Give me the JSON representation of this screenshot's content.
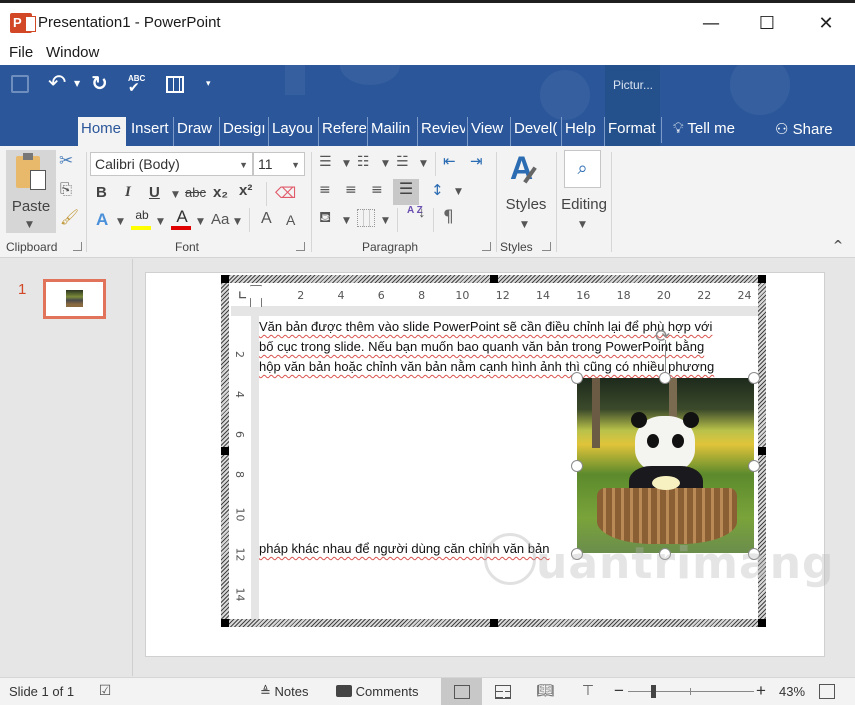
{
  "window": {
    "title": "Presentation1 - PowerPoint",
    "app_icon": "powerpoint-logo-icon",
    "controls": {
      "minimize": "—",
      "maximize": "☐",
      "close": "✕"
    }
  },
  "menubar": {
    "items": [
      "File",
      "Window"
    ]
  },
  "quick_access": {
    "icons": [
      "save-icon",
      "undo-icon",
      "undo-dropdown-icon",
      "redo-icon",
      "spelling-icon",
      "table-draw-icon",
      "customize-toolbar-icon"
    ],
    "spelling_label": "ABC"
  },
  "contextual_tab_group": "Pictur...",
  "tabs": [
    {
      "label": "Home",
      "active": true
    },
    {
      "label": "Insert"
    },
    {
      "label": "Draw"
    },
    {
      "label": "Desigı"
    },
    {
      "label": "Layou"
    },
    {
      "label": "Refere"
    },
    {
      "label": "Mailin"
    },
    {
      "label": "Reviev"
    },
    {
      "label": "View"
    },
    {
      "label": "Devel("
    },
    {
      "label": "Help"
    },
    {
      "label": "Format"
    }
  ],
  "tell_me": "Tell me",
  "share": "Share",
  "ribbon": {
    "clipboard": {
      "paste_label": "Paste",
      "group_label": "Clipboard",
      "icons": [
        "paste-icon",
        "cut-icon",
        "copy-icon",
        "format-painter-icon"
      ]
    },
    "font": {
      "font_name": "Calibri (Body)",
      "font_size": "11",
      "bold": "B",
      "italic": "I",
      "underline": "U",
      "strikethrough": "abc",
      "subscript": "x₂",
      "superscript": "x²",
      "text_effects": "A",
      "highlight": "ab",
      "font_color": "A",
      "change_case": "Aa",
      "grow": "A",
      "shrink": "A",
      "group_label": "Font",
      "highlight_color": "#ffff00",
      "font_color_value": "#e00000"
    },
    "paragraph": {
      "group_label": "Paragraph",
      "icons": [
        "bullets-icon",
        "numbering-icon",
        "multilevel-list-icon",
        "decrease-indent-icon",
        "increase-indent-icon",
        "align-left-icon",
        "align-center-icon",
        "align-right-icon",
        "justify-icon",
        "line-spacing-icon",
        "shading-icon",
        "borders-icon",
        "sort-icon",
        "show-marks-icon"
      ],
      "sort_label": "A Z",
      "pilcrow": "¶"
    },
    "styles": {
      "label": "Styles",
      "group_label": "Styles"
    },
    "editing": {
      "label": "Editing"
    },
    "collapse_icon": "^"
  },
  "slides_pane": {
    "slides": [
      {
        "number": "1"
      }
    ]
  },
  "document": {
    "ruler_h": [
      "2",
      "4",
      "6",
      "8",
      "10",
      "12",
      "14",
      "16",
      "18",
      "20",
      "22",
      "24"
    ],
    "ruler_v": [
      "2",
      "4",
      "6",
      "8",
      "10",
      "12",
      "14"
    ],
    "lines": [
      "Văn bản được thêm vào slide PowerPoint sẽ cần điều chỉnh lại để phù hợp với",
      "bố cục trong slide. Nếu bạn muốn bao quanh văn bản trong PowerPoint bằng",
      "hộp văn bản hoặc chỉnh văn bản nằm cạnh hình ảnh thì cũng có nhiều phương",
      "pháp khác nhau để người dùng căn chỉnh văn bản"
    ],
    "watermark": "uantrimang",
    "picture": "panda-in-basket-image"
  },
  "statusbar": {
    "slide_info": "Slide 1 of 1",
    "notes": "Notes",
    "comments": "Comments",
    "zoom": "43%",
    "zoom_fraction": 0.43,
    "view_icons": [
      "normal-view-icon",
      "slide-sorter-icon",
      "reading-view-icon",
      "slideshow-icon"
    ]
  }
}
